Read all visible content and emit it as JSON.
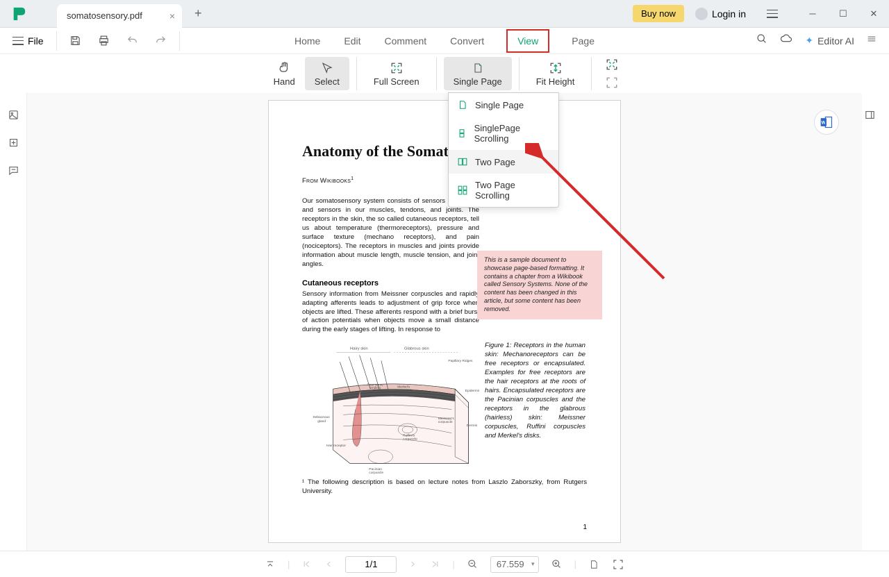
{
  "titlebar": {
    "tab_title": "somatosensory.pdf",
    "buy_now": "Buy now",
    "login": "Login in"
  },
  "topbar": {
    "file": "File"
  },
  "menu": {
    "home": "Home",
    "edit": "Edit",
    "comment": "Comment",
    "convert": "Convert",
    "view": "View",
    "page": "Page",
    "editor_ai": "Editor AI"
  },
  "ribbon": {
    "hand": "Hand",
    "select": "Select",
    "full_screen": "Full Screen",
    "single_page": "Single Page",
    "fit_height": "Fit Height"
  },
  "dropdown": {
    "single_page": "Single Page",
    "single_scroll": "SinglePage Scrolling",
    "two_page": "Two Page",
    "two_scroll": "Two Page Scrolling"
  },
  "document": {
    "title": "Anatomy of the Somatosensory System",
    "from": "From Wikibooks",
    "intro": "Our somatosensory system consists of sensors in the skin and sensors in our muscles, tendons, and joints. The receptors in the skin, the so called cutaneous receptors, tell us about temperature (thermoreceptors), pressure and surface texture (mechano receptors), and pain (nociceptors). The receptors in muscles and joints provide information about muscle length, muscle tension, and joint angles.",
    "note": "This is a sample document to showcase page-based formatting. It contains a chapter from a Wikibook called Sensory Systems. None of the content has been changed in this article, but some content has been removed.",
    "h2": "Cutaneous receptors",
    "cut_text": "Sensory information from Meissner corpuscles and rapidly adapting afferents leads to adjustment of grip force when objects are lifted. These afferents respond with a brief burst of action potentials when objects move a small distance during the early stages of lifting. In response to",
    "fig_caption": "Figure 1:  Receptors in the human skin: Mechanoreceptors can be free receptors or encapsulated. Examples for free receptors are the hair receptors at the roots of hairs. Encapsulated receptors are the Pacinian corpuscles and the receptors in the glabrous (hairless) skin: Meissner corpuscles, Ruffini corpuscles and Merkel's disks.",
    "footnote_text": "¹ The following description is based on lecture notes from Laszlo Zaborszky, from Rutgers University.",
    "page_num": "1"
  },
  "bottombar": {
    "page_count": "1/1",
    "zoom": "67.559"
  }
}
